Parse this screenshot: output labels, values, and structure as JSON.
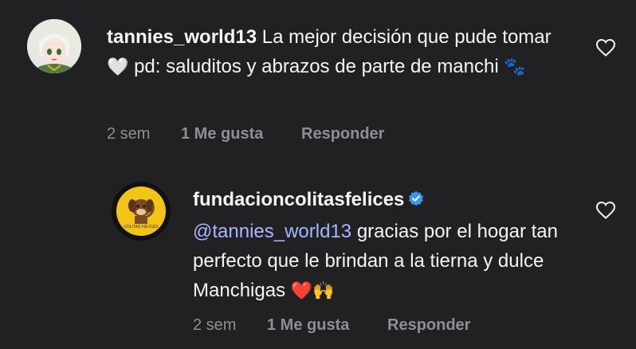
{
  "comments": [
    {
      "username": "tannies_world13",
      "text_part1": "La mejor decisión que pude tomar",
      "emoji1": "🤍",
      "text_part2": "pd: saluditos y abrazos de parte de manchi",
      "emoji2": "🐾",
      "time": "2 sem",
      "likes": "1 Me gusta",
      "reply": "Responder",
      "avatar_icon": "anime-girl-avatar"
    },
    {
      "username": "fundacioncolitasfelices",
      "verified": true,
      "mention": "@tannies_world13",
      "text": "gracias por el hogar tan perfecto que le brindan a la tierna y dulce Manchigas",
      "emoji": "❤️🙌",
      "time": "2 sem",
      "likes": "1 Me gusta",
      "reply": "Responder",
      "avatar_icon": "dog-logo-avatar",
      "avatar_text": "COLITAS FELICES"
    }
  ],
  "colors": {
    "background": "#212124",
    "text": "#f5f5f5",
    "meta": "#8e8e94",
    "mention": "#a8b6ff",
    "verified": "#3897f0",
    "heart_emoji": "#ffffff",
    "red_heart": "#e0245e"
  }
}
